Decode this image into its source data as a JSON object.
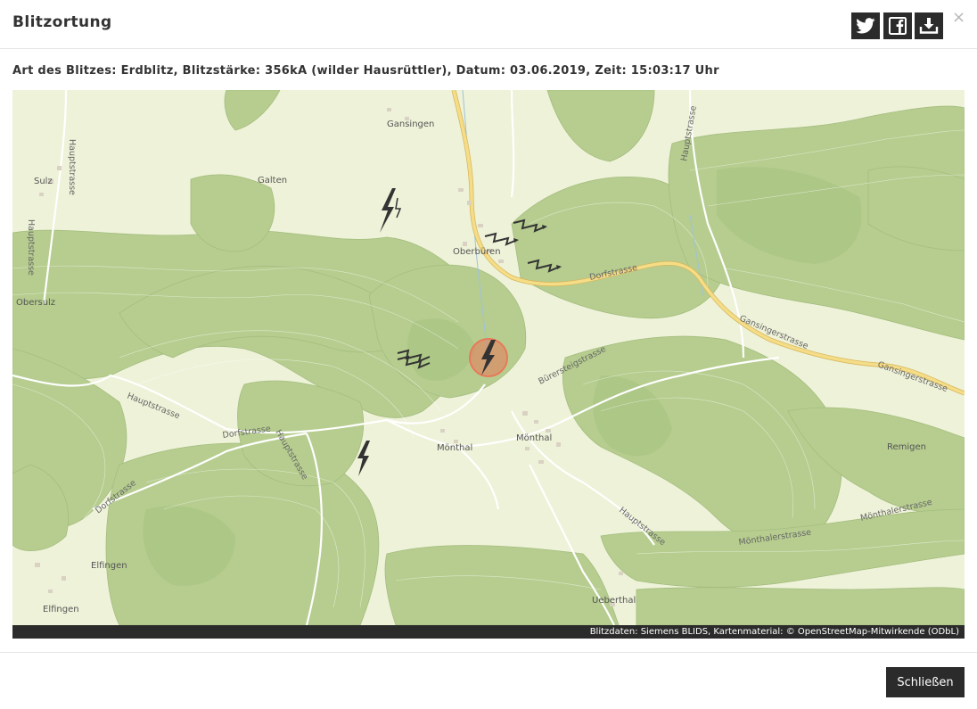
{
  "modal": {
    "title": "Blitzortung",
    "close_symbol": "×",
    "share_buttons": [
      {
        "name": "twitter",
        "icon": "twitter-icon"
      },
      {
        "name": "facebook",
        "icon": "facebook-icon"
      },
      {
        "name": "download",
        "icon": "download-icon"
      }
    ]
  },
  "info": {
    "text": "Art des Blitzes: Erdblitz, Blitzstärke: 356kA (wilder Hausrüttler), Datum: 03.06.2019, Zeit: 15:03:17 Uhr"
  },
  "map": {
    "places": {
      "gansingen": "Gansingen",
      "sulz": "Sulz",
      "galten": "Galten",
      "oberburen": "Oberbüren",
      "obersulz": "Obersulz",
      "monthal_small": "Mönthal",
      "monthal": "Mönthal",
      "remigen": "Remigen",
      "elfingen_1": "Elfingen",
      "elfingen_2": "Elfingen",
      "ueberthal": "Ueberthal"
    },
    "streets": {
      "hauptstrasse_top": "Hauptstrasse",
      "hauptstrasse_left": "Hauptstrasse",
      "hauptstrasse_nw": "Hauptstrasse",
      "hauptstrasse_mid": "Hauptstrasse",
      "hauptstrasse_center": "Hauptstrasse",
      "hauptstrasse_se": "Hauptstrasse",
      "dorfstrasse_ne": "Dorfstrasse",
      "dorfstrasse_mid": "Dorfstrasse",
      "dorfstrasse_sw": "Dorfstrasse",
      "burersteigstrasse": "Bürersteigstrasse",
      "gansingerstrasse_1": "Gansingerstrasse",
      "gansingerstrasse_2": "Gansingerstrasse",
      "monthalerstrasse_1": "Mönthalerstrasse",
      "monthalerstrasse_2": "Mönthalerstrasse"
    },
    "attribution": "Blitzdaten: Siemens BLIDS, Kartenmaterial: © OpenStreetMap-Mitwirkende (ODbL)",
    "colors": {
      "forest": "#b5cc8e",
      "forest_dark": "#a7c281",
      "meadow": "#eef2d8",
      "main_road": "#f4d77a",
      "strike_highlight": "#e8795a"
    }
  },
  "footer": {
    "close_label": "Schließen"
  }
}
